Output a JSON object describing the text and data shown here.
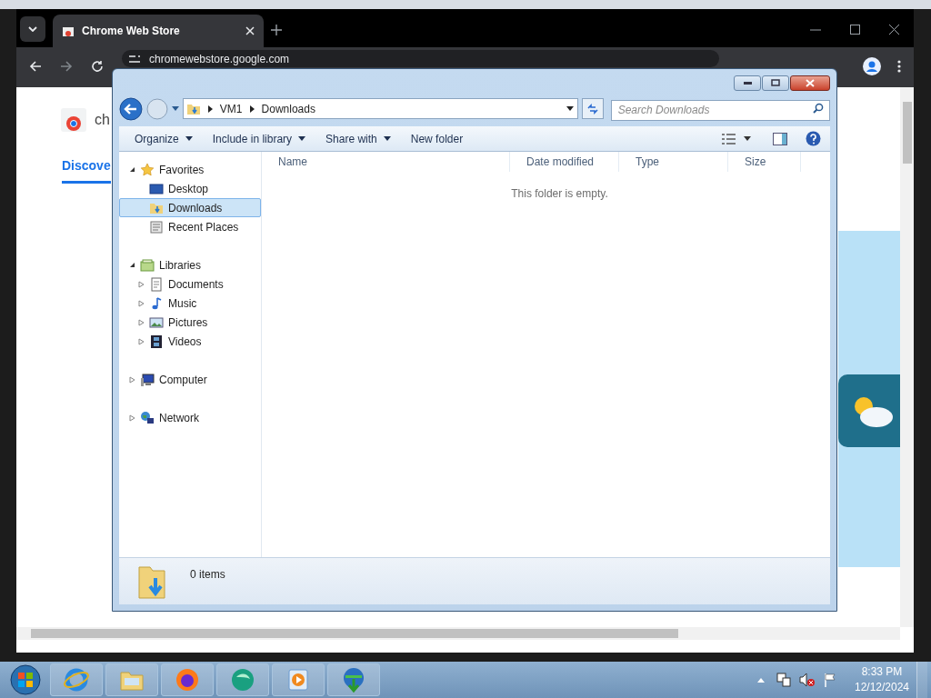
{
  "browser": {
    "tab": {
      "title": "Chrome Web Store"
    },
    "url": "chromewebstore.google.com",
    "page": {
      "site_label": "ch",
      "nav_tab": "Discove"
    }
  },
  "explorer": {
    "breadcrumb": [
      "VM1",
      "Downloads"
    ],
    "search": {
      "placeholder": "Search Downloads"
    },
    "toolbar": [
      {
        "label": "Organize",
        "dropdown": true
      },
      {
        "label": "Include in library",
        "dropdown": true
      },
      {
        "label": "Share with",
        "dropdown": true
      },
      {
        "label": "New folder",
        "dropdown": false
      }
    ],
    "nav": [
      {
        "label": "Favorites",
        "kind": "star",
        "expanded": true,
        "selected": false,
        "children": [
          {
            "label": "Desktop",
            "kind": "desktop",
            "selected": false
          },
          {
            "label": "Downloads",
            "kind": "downloads",
            "selected": true
          },
          {
            "label": "Recent Places",
            "kind": "recent",
            "selected": false
          }
        ]
      },
      {
        "label": "Libraries",
        "kind": "libraries",
        "expanded": true,
        "selected": false,
        "children": [
          {
            "label": "Documents",
            "kind": "documents",
            "expanded": false,
            "selected": false
          },
          {
            "label": "Music",
            "kind": "music",
            "expanded": false,
            "selected": false
          },
          {
            "label": "Pictures",
            "kind": "pictures",
            "expanded": false,
            "selected": false
          },
          {
            "label": "Videos",
            "kind": "videos",
            "expanded": false,
            "selected": false
          }
        ]
      },
      {
        "label": "Computer",
        "kind": "computer",
        "expanded": false,
        "selected": false
      },
      {
        "label": "Network",
        "kind": "network",
        "expanded": false,
        "selected": false
      }
    ],
    "columns": [
      "Name",
      "Date modified",
      "Type",
      "Size"
    ],
    "empty_message": "This folder is empty.",
    "status": "0 items"
  },
  "taskbar": {
    "apps": [
      {
        "kind": "ie"
      },
      {
        "kind": "folder"
      },
      {
        "kind": "firefox"
      },
      {
        "kind": "greenglobe"
      },
      {
        "kind": "player"
      },
      {
        "kind": "download"
      }
    ],
    "clock": {
      "time": "8:33 PM",
      "date": "12/12/2024"
    }
  }
}
